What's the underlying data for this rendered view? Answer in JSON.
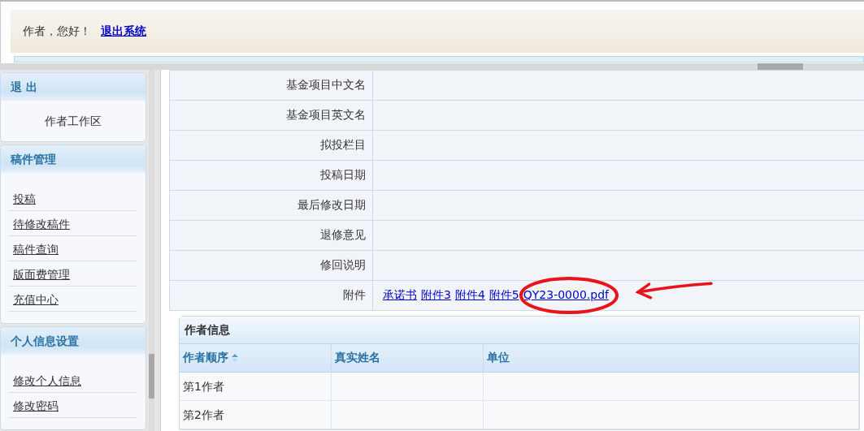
{
  "header": {
    "greeting": "作者，您好！",
    "logout_link": "退出系统"
  },
  "sidebar": {
    "sections": [
      {
        "title": "退 出",
        "kind": "label",
        "items": [
          "作者工作区"
        ]
      },
      {
        "title": "稿件管理",
        "kind": "links",
        "items": [
          "投稿",
          "待修改稿件",
          "稿件查询",
          "版面费管理",
          "充值中心"
        ]
      },
      {
        "title": "个人信息设置",
        "kind": "links",
        "items": [
          "修改个人信息",
          "修改密码"
        ]
      }
    ]
  },
  "form": {
    "rows": [
      {
        "label": "基金项目中文名"
      },
      {
        "label": "基金项目英文名"
      },
      {
        "label": "拟投栏目"
      },
      {
        "label": "投稿日期"
      },
      {
        "label": "最后修改日期"
      },
      {
        "label": "退修意见"
      },
      {
        "label": "修回说明"
      },
      {
        "label": "附件",
        "links": [
          {
            "text": "承诺书",
            "circled": false
          },
          {
            "text": "附件3",
            "circled": false
          },
          {
            "text": "附件4",
            "circled": false
          },
          {
            "text": "附件5",
            "circled": false
          },
          {
            "text": "QY23-0000.pdf",
            "circled": true
          }
        ]
      }
    ]
  },
  "author_table": {
    "title": "作者信息",
    "columns": [
      {
        "label": "作者顺序",
        "sortable": true
      },
      {
        "label": "真实姓名",
        "sortable": false
      },
      {
        "label": "单位",
        "sortable": false
      }
    ],
    "rows": [
      [
        "第1作者",
        "",
        ""
      ],
      [
        "第2作者",
        "",
        ""
      ]
    ]
  }
}
